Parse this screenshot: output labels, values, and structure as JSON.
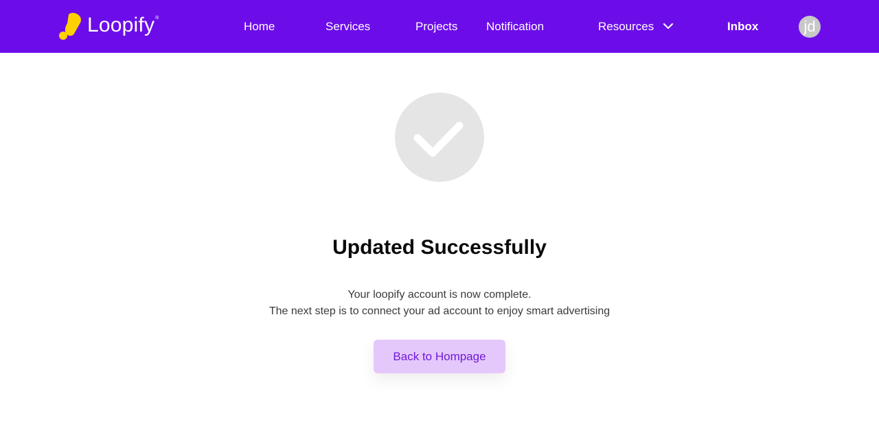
{
  "brand": {
    "name": "Loopify",
    "registered_mark": "®",
    "logo_color": "#ffd100"
  },
  "nav": {
    "background": "#6c0de9",
    "items": [
      {
        "label": "Home"
      },
      {
        "label": "Services"
      },
      {
        "label": "Projects"
      },
      {
        "label": "Notification"
      },
      {
        "label": "Resources",
        "has_dropdown": true,
        "icon": "chevron-down-icon"
      },
      {
        "label": "Inbox",
        "bold": true
      }
    ],
    "avatar_initials": "jd"
  },
  "main": {
    "status_icon": "check-circle-icon",
    "title": "Updated Successfully",
    "message_line_1": "Your loopify account is now complete.",
    "message_line_2": "The next step is to connect your ad account to enjoy smart advertising",
    "button_label": "Back to Hompage",
    "button_color": "#e5c8fb",
    "button_text_color": "#6d1ad9"
  }
}
